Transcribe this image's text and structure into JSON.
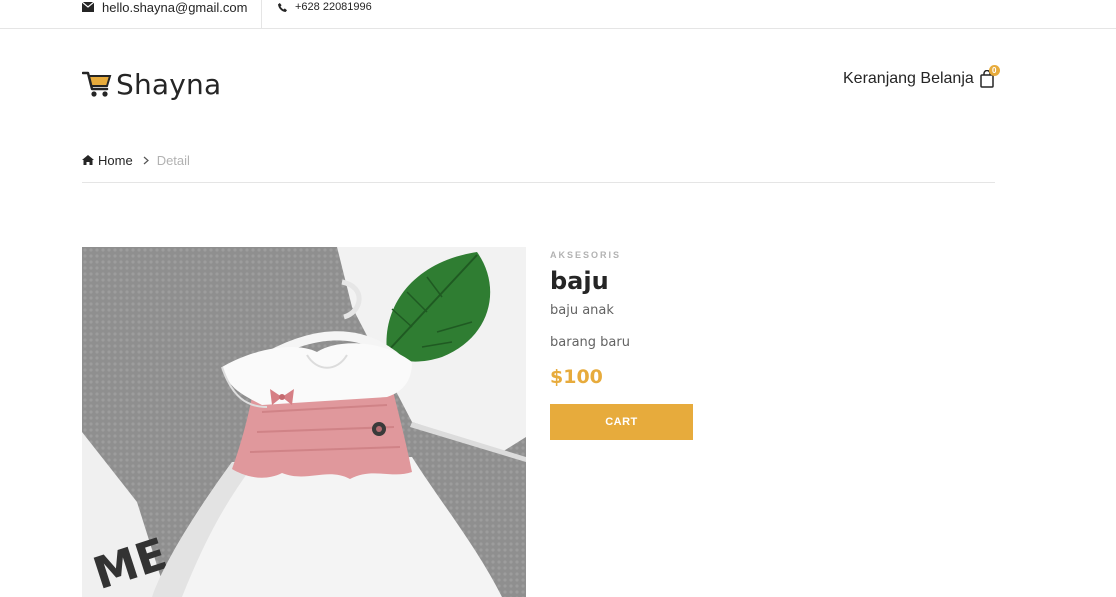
{
  "topbar": {
    "email": "hello.shayna@gmail.com",
    "phone": "+628 22081996"
  },
  "header": {
    "brand": "Shayna",
    "cart_label": "Keranjang Belanja",
    "cart_count": "0"
  },
  "breadcrumb": {
    "home": "Home",
    "current": "Detail"
  },
  "product": {
    "category": "AKSESORIS",
    "name": "baju",
    "description": "baju anak",
    "condition": "barang baru",
    "price": "$100",
    "cart_button": "CART"
  },
  "colors": {
    "accent": "#e7ab3c",
    "text": "#252525",
    "muted": "#b2b2b2"
  }
}
